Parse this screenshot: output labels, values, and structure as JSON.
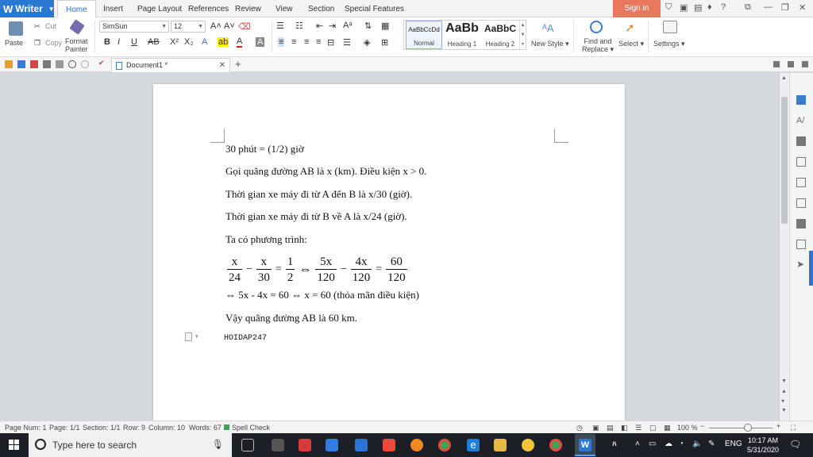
{
  "app": {
    "name": "Writer",
    "signin_label": "Sign in"
  },
  "tabs": [
    "Home",
    "Insert",
    "Page Layout",
    "References",
    "Review",
    "View",
    "Section",
    "Special Features"
  ],
  "ribbon": {
    "paste": "Paste",
    "cut": "Cut",
    "copy": "Copy",
    "format_painter_1": "Format",
    "format_painter_2": "Painter",
    "font_name": "SimSun",
    "font_size": "12",
    "styles": [
      {
        "sample": "AaBbCcDd",
        "label": "Normal"
      },
      {
        "sample": "AaBb",
        "label": "Heading 1"
      },
      {
        "sample": "AaBbC",
        "label": "Heading 2"
      }
    ],
    "new_style": "New Style",
    "find_replace_1": "Find and",
    "find_replace_2": "Replace",
    "select": "Select",
    "settings": "Settings"
  },
  "document_tab": {
    "title": "Document1 *"
  },
  "document": {
    "lines": [
      "30 phút = (1/2) giờ",
      "Gọi quãng đường AB là x (km). Điều kiện x > 0.",
      "Thời gian xe máy đi từ A đến B là x/30 (giờ).",
      "Thời gian xe máy đi từ B về A là x/24 (giờ).",
      "Ta có phương trình:"
    ],
    "equation": {
      "f1_num": "x",
      "f1_den": "24",
      "f2_num": "x",
      "f2_den": "30",
      "f3_num": "1",
      "f3_den": "2",
      "f4_num": "5x",
      "f4_den": "120",
      "f5_num": "4x",
      "f5_den": "120",
      "f6_num": "60",
      "f6_den": "120",
      "minus": "−",
      "equals": "=",
      "iff": "⇔"
    },
    "after_lines": [
      "⇔ 5x - 4x = 60 ⇔ x = 60 (thỏa mãn điều kiện)",
      "Vậy quãng đường AB là 60 km."
    ],
    "footer_text": "HOIDAP247"
  },
  "status": {
    "page_num": "Page Num: 1",
    "page": "Page: 1/1",
    "section": "Section: 1/1",
    "row": "Row: 9",
    "column": "Column: 10",
    "words": "Words: 67",
    "spell": "Spell Check",
    "zoom": "100 %"
  },
  "taskbar": {
    "search_placeholder": "Type here to search",
    "lang": "ENG",
    "time": "10:17 AM",
    "date": "5/31/2020"
  }
}
